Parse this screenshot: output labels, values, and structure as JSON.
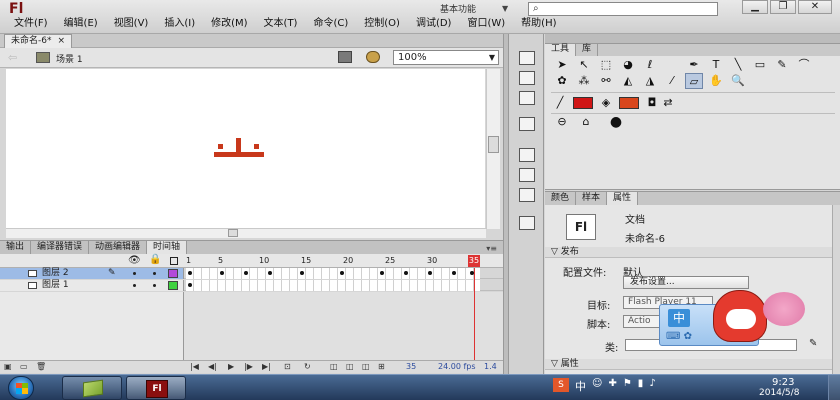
{
  "app": {
    "logo": "Fl",
    "workspace": "基本功能",
    "search_icon": "⌕"
  },
  "window_controls": {
    "minimize": "▁",
    "restore": "❐",
    "close": "✕"
  },
  "menu": [
    "文件(F)",
    "编辑(E)",
    "视图(V)",
    "插入(I)",
    "修改(M)",
    "文本(T)",
    "命令(C)",
    "控制(O)",
    "调试(D)",
    "窗口(W)",
    "帮助(H)"
  ],
  "document": {
    "tab_label": "未命名-6*",
    "tab_close": "×"
  },
  "scene": {
    "label": "场景 1",
    "zoom": "100%"
  },
  "stage": {
    "art_text": "山",
    "art_color": "#c8381b"
  },
  "panel_tabs": [
    "输出",
    "编译器错误",
    "动画编辑器",
    "时间轴"
  ],
  "panel_tabs_active": 3,
  "timeline": {
    "ruler": [
      "1",
      "5",
      "10",
      "15",
      "20",
      "25",
      "30",
      "35"
    ],
    "current_frame": "35",
    "layers": [
      {
        "name": "图层 2",
        "color": "#b24ad9",
        "selected": true
      },
      {
        "name": "图层 1",
        "color": "#3fd13f",
        "selected": false
      }
    ],
    "footer_frame": "35",
    "fps": "24.00 fps",
    "time": "1.4"
  },
  "tools": {
    "tabs": [
      "工具",
      "库"
    ],
    "stroke_color": "#d01616",
    "fill_color": "#d8461c"
  },
  "properties": {
    "tabs": [
      "颜色",
      "样本",
      "属性"
    ],
    "doc_type": "文档",
    "doc_name": "未命名-6",
    "doc_icon": "Fl",
    "section_publish": "发布",
    "profile_label": "配置文件:",
    "profile_value": "默认",
    "publish_settings": "发布设置...",
    "target_label": "目标:",
    "target_value": "Flash Player 11",
    "script_label": "脚本:",
    "script_value": "Actio",
    "class_label": "类:",
    "section_properties": "属性"
  },
  "ime": {
    "mode": "中"
  },
  "taskbar": {
    "tray_sg": "S",
    "tray_zh": "中",
    "time": "9:23",
    "date": "2014/5/8",
    "fl_label": "Fl"
  }
}
